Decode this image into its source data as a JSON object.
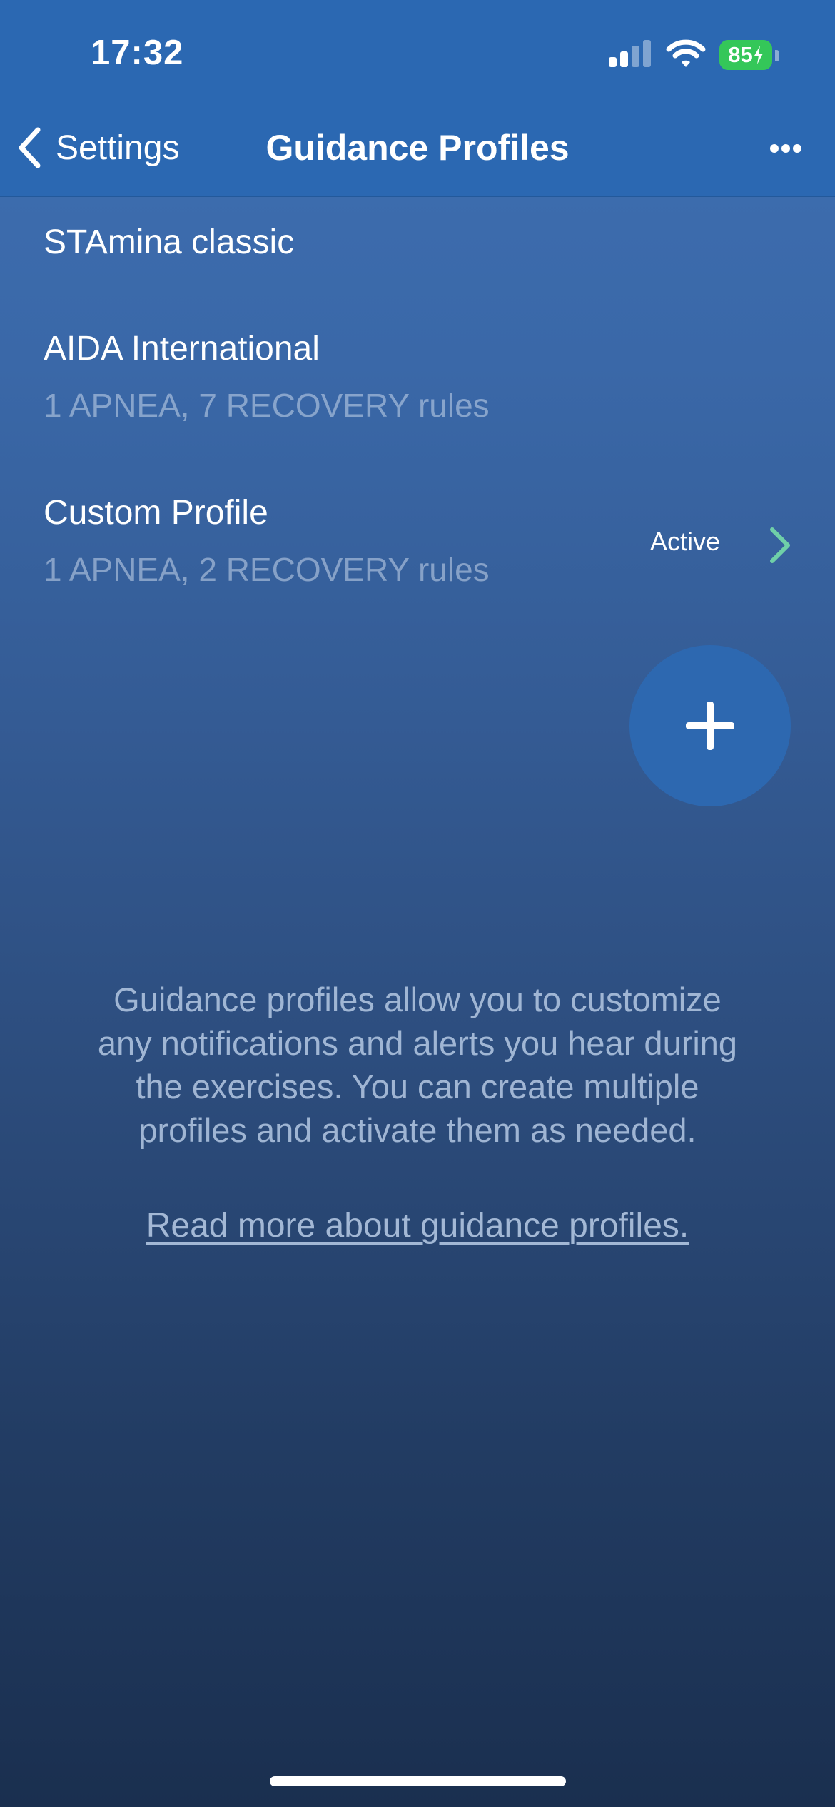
{
  "status_bar": {
    "time": "17:32",
    "battery_level": "85",
    "icons": [
      "signal-icon",
      "wifi-icon",
      "battery-charging-icon"
    ]
  },
  "nav": {
    "back_label": "Settings",
    "title": "Guidance Profiles",
    "more_icon": "ellipsis-icon"
  },
  "profiles": [
    {
      "name": "STAmina classic",
      "rules": ""
    },
    {
      "name": "AIDA International",
      "rules": "1 APNEA, 7 RECOVERY rules"
    },
    {
      "name": "Custom Profile",
      "rules": "1 APNEA, 2 RECOVERY rules",
      "status": "Active"
    }
  ],
  "add_button_icon": "plus-icon",
  "info": {
    "text": "Guidance profiles allow you to customize any notifications and alerts you hear during the exercises. You can create multiple profiles and activate them as needed.",
    "link": "Read more about guidance profiles."
  },
  "colors": {
    "nav_background": "#2b68b2",
    "accent_green": "#6fcfa8",
    "battery_green": "#34c759",
    "fab_background": "#2d68b0"
  }
}
